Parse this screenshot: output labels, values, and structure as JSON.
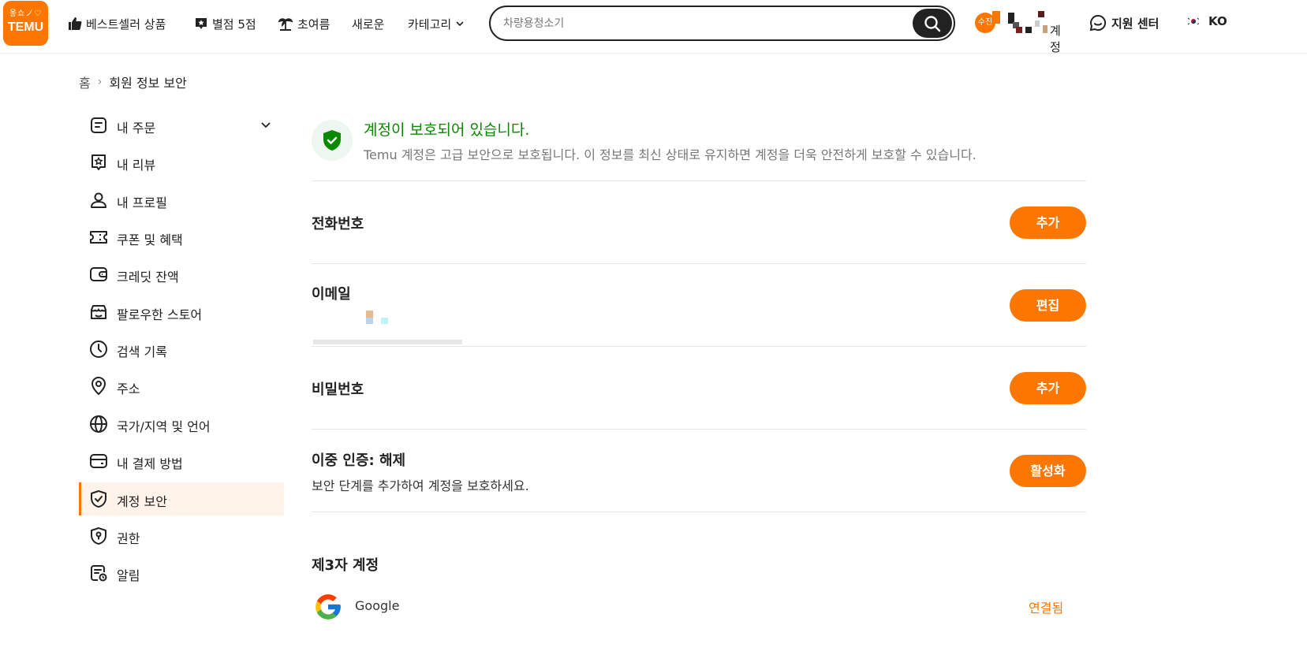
{
  "header": {
    "logo_text": "TEMU",
    "logo_marks": "옿쇼ノ♡",
    "nav": {
      "bestseller": "베스트셀러 상품",
      "five_star": "별점 5점",
      "summer": "초여름",
      "new": "새로운",
      "category": "카테고리"
    },
    "search_placeholder": "차량용청소기",
    "account_badge": "수진",
    "account_label": "계정",
    "support": "지원 센터",
    "language": "KO"
  },
  "breadcrumb": {
    "home": "홈",
    "separator": "›",
    "current": "회원 정보 보안"
  },
  "sidebar": {
    "items": [
      {
        "label": "내 주문",
        "icon": "order-icon"
      },
      {
        "label": "내 리뷰",
        "icon": "review-icon"
      },
      {
        "label": "내 프로필",
        "icon": "profile-icon"
      },
      {
        "label": "쿠폰 및 혜택",
        "icon": "coupon-icon"
      },
      {
        "label": "크레딧 잔액",
        "icon": "wallet-icon"
      },
      {
        "label": "팔로우한 스토어",
        "icon": "store-icon"
      },
      {
        "label": "검색 기록",
        "icon": "clock-icon"
      },
      {
        "label": "주소",
        "icon": "location-icon"
      },
      {
        "label": "국가/지역 및 언어",
        "icon": "globe-icon"
      },
      {
        "label": "내 결제 방법",
        "icon": "card-icon"
      },
      {
        "label": "계정 보안",
        "icon": "shield-check-icon",
        "active": true
      },
      {
        "label": "권한",
        "icon": "shield-lock-icon"
      },
      {
        "label": "알림",
        "icon": "notification-icon"
      }
    ]
  },
  "main": {
    "status_title": "계정이 보호되어 있습니다.",
    "status_desc": "Temu 계정은 고급 보안으로 보호됩니다. 이 정보를 최신 상태로 유지하면 계정을 더욱 안전하게 보호할 수 있습니다.",
    "phone": {
      "title": "전화번호",
      "button": "추가"
    },
    "email": {
      "title": "이메일",
      "button": "편집"
    },
    "password": {
      "title": "비밀번호",
      "button": "추가"
    },
    "two_factor": {
      "title": "이중 인증: 해제",
      "desc": "보안 단계를 추가하여 계정을 보호하세요.",
      "button": "활성화"
    },
    "third_party": {
      "title": "제3자 계정",
      "accounts": [
        {
          "name": "Google",
          "status": "연결됨"
        }
      ]
    }
  },
  "colors": {
    "brand": "#fb7701",
    "success": "#0a8800",
    "active_bg": "#fff3ea"
  }
}
